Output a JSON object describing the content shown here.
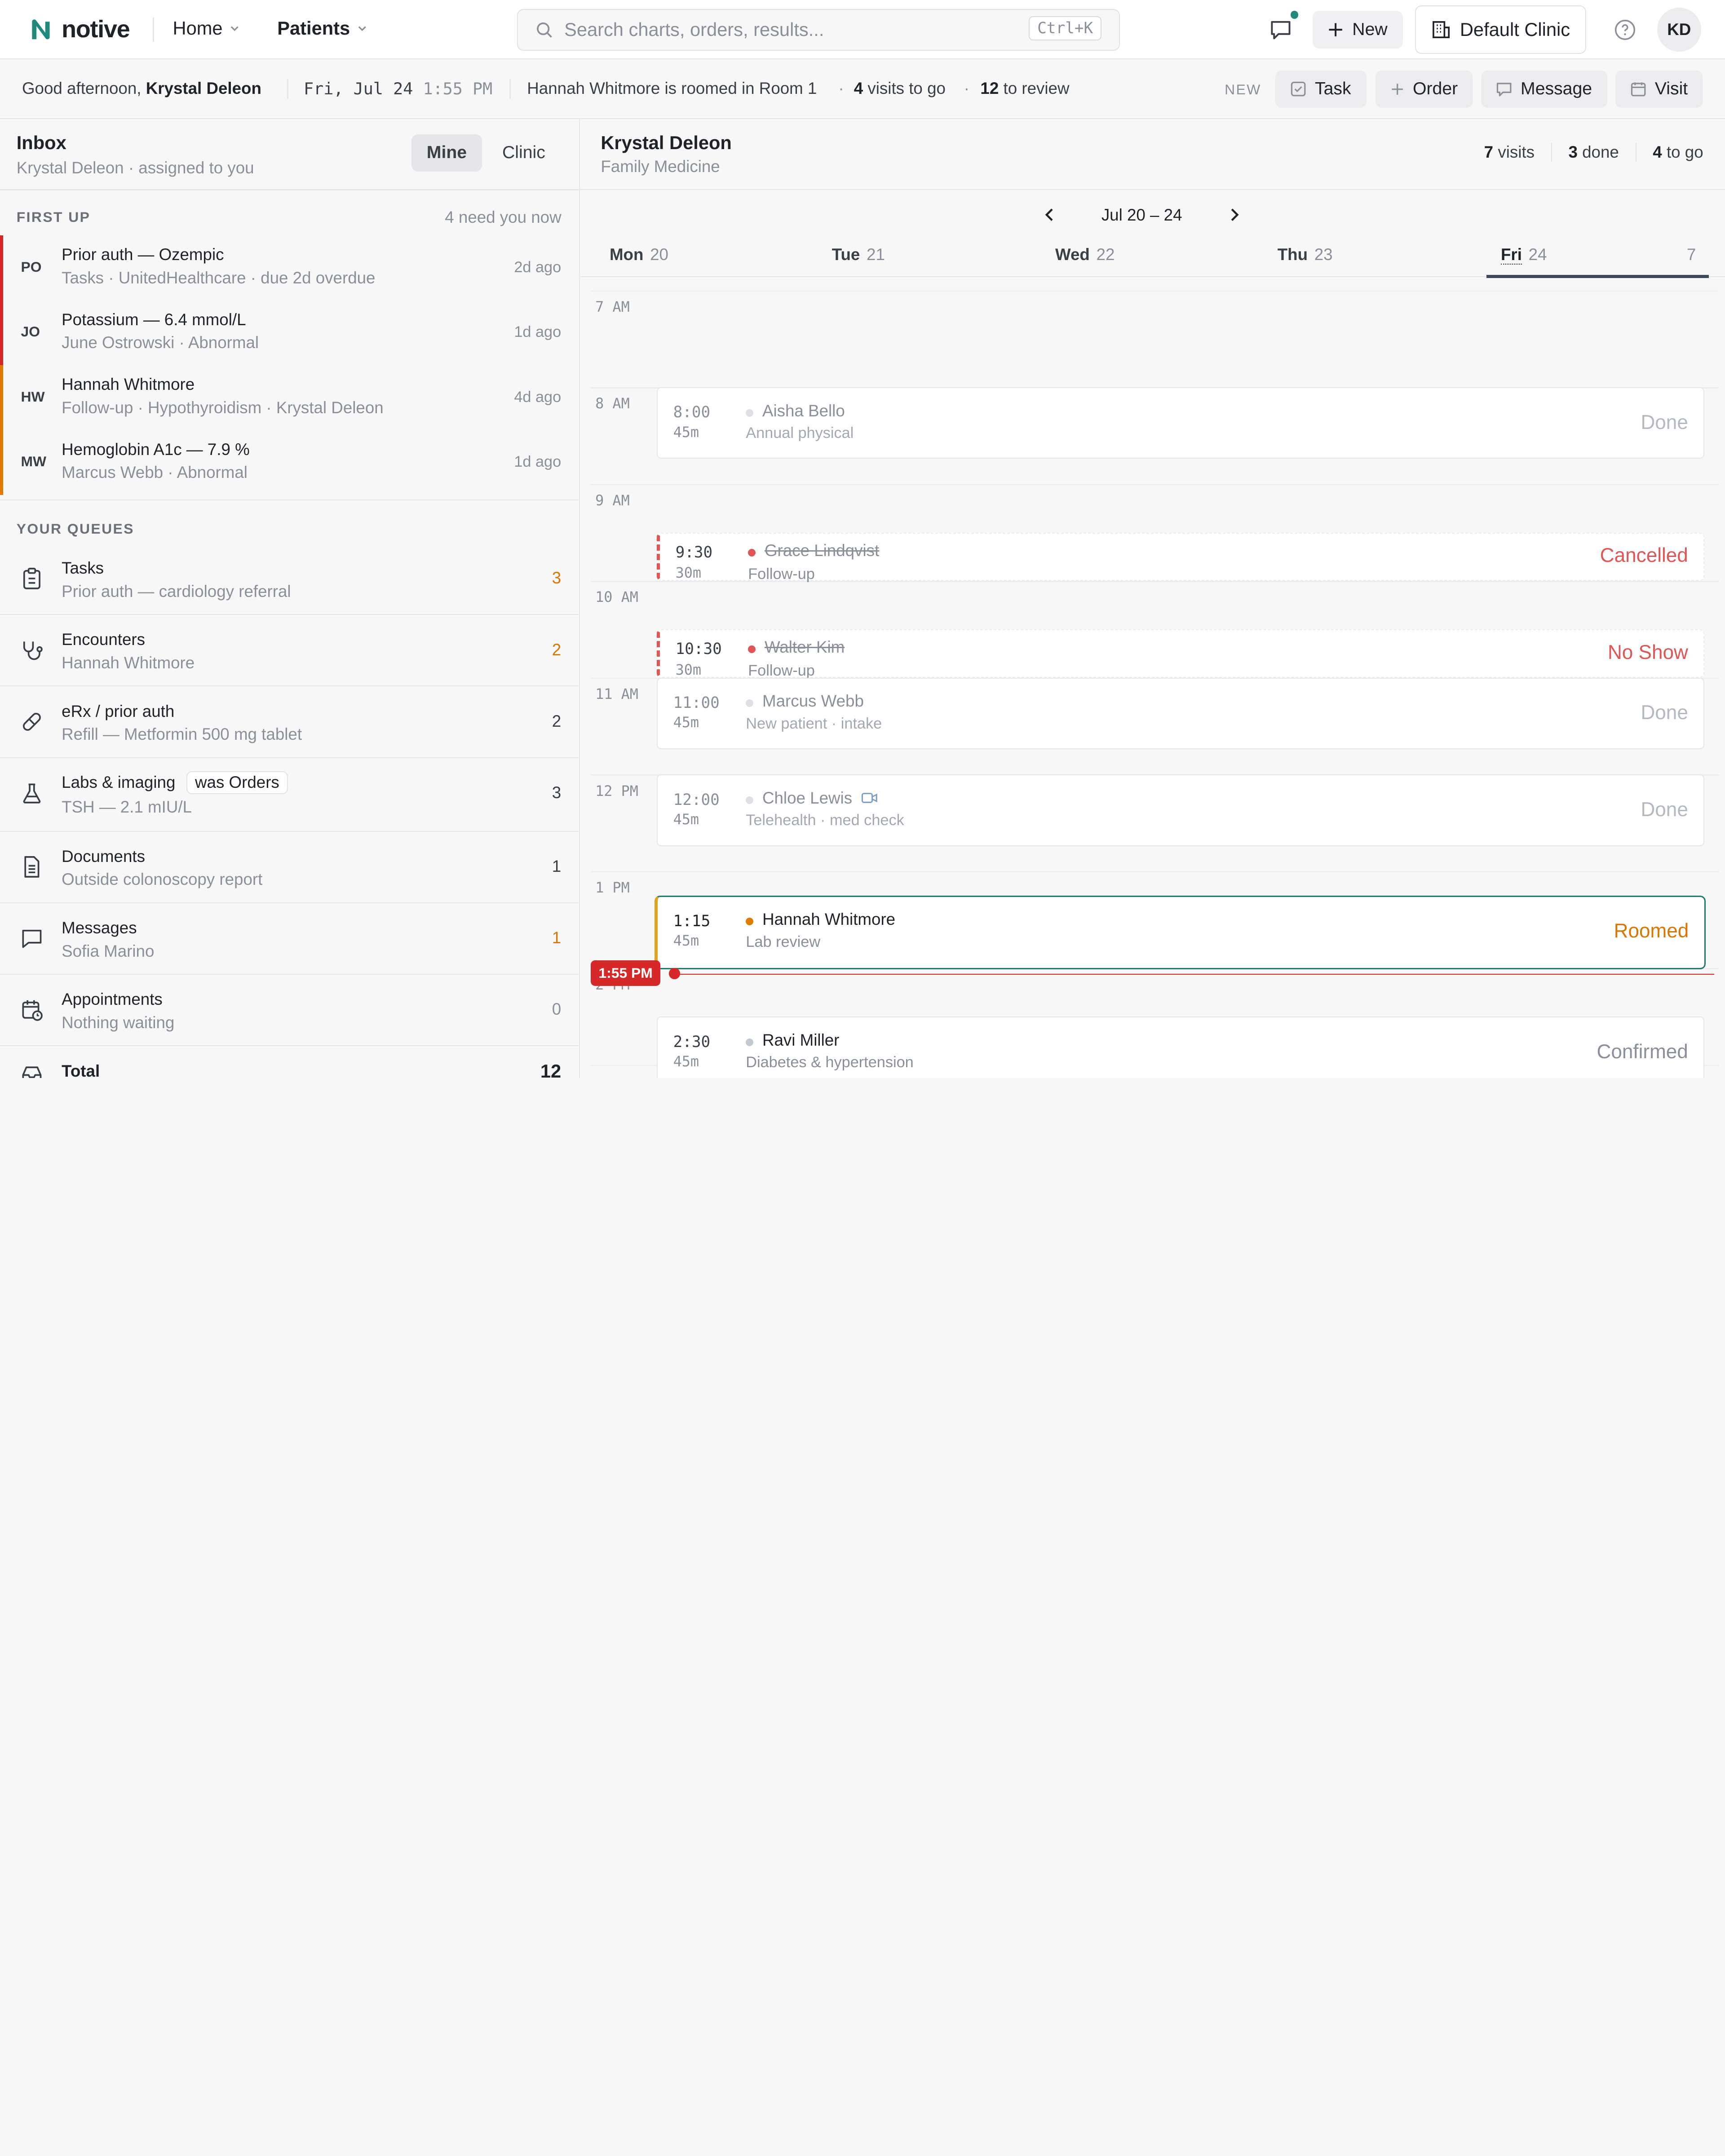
{
  "brand": {
    "name": "notive",
    "color": "#1f8a7c"
  },
  "nav": {
    "home": "Home",
    "patients": "Patients"
  },
  "search": {
    "placeholder": "Search charts, orders, results...",
    "shortcut": "Ctrl+K"
  },
  "header": {
    "new_label": "New",
    "clinic_label": "Default Clinic",
    "avatar": "KD"
  },
  "subbar": {
    "greeting": "Good afternoon,",
    "user": "Krystal Deleon",
    "date": "Fri, Jul 24",
    "time": "1:55 PM",
    "roomed": "Hannah Whitmore is roomed in Room 1",
    "visits_count": "4",
    "visits_label": "visits to go",
    "review_count": "12",
    "review_label": "to review",
    "new_label": "NEW",
    "quick": {
      "task": "Task",
      "order": "Order",
      "message": "Message",
      "visit": "Visit"
    }
  },
  "inbox": {
    "title": "Inbox",
    "subtitle": "Krystal Deleon · assigned to you",
    "tabs": {
      "mine": "Mine",
      "clinic": "Clinic"
    },
    "first_up": {
      "heading": "FIRST UP",
      "note": "4 need you now"
    },
    "items": [
      {
        "initials": "PO",
        "title": "Prior auth — Ozempic",
        "sub": "Tasks · UnitedHealthcare · due 2d overdue",
        "age": "2d ago",
        "color": "#d62828"
      },
      {
        "initials": "JO",
        "title": "Potassium — 6.4 mmol/L",
        "sub": "June Ostrowski · Abnormal",
        "age": "1d ago",
        "color": "#d62828"
      },
      {
        "initials": "HW",
        "title": "Hannah Whitmore",
        "sub": "Follow-up · Hypothyroidism · Krystal Deleon",
        "age": "4d ago",
        "color": "#e07b00"
      },
      {
        "initials": "MW",
        "title": "Hemoglobin A1c — 7.9 %",
        "sub": "Marcus Webb · Abnormal",
        "age": "1d ago",
        "color": "#e07b00"
      }
    ],
    "queues_heading": "YOUR QUEUES",
    "queues": [
      {
        "icon": "clipboard-icon",
        "title": "Tasks",
        "sub": "Prior auth — cardiology referral",
        "count": "3",
        "count_color": "#d97706"
      },
      {
        "icon": "stethoscope-icon",
        "title": "Encounters",
        "sub": "Hannah Whitmore",
        "count": "2",
        "count_color": "#d97706"
      },
      {
        "icon": "pill-icon",
        "title": "eRx / prior auth",
        "sub": "Refill — Metformin 500 mg tablet",
        "count": "2",
        "count_color": "#3a3f46"
      },
      {
        "icon": "flask-icon",
        "title": "Labs & imaging",
        "badge": "was Orders",
        "sub": "TSH — 2.1 mIU/L",
        "count": "3",
        "count_color": "#3a3f46"
      },
      {
        "icon": "document-icon",
        "title": "Documents",
        "sub": "Outside colonoscopy report",
        "count": "1",
        "count_color": "#3a3f46"
      },
      {
        "icon": "message-icon",
        "title": "Messages",
        "sub": "Sofia Marino",
        "count": "1",
        "count_color": "#d97706"
      },
      {
        "icon": "calendar-clock-icon",
        "title": "Appointments",
        "sub": "Nothing waiting",
        "count": "0",
        "count_color": "#8a8f98"
      }
    ],
    "total_label": "Total",
    "total_count": "12"
  },
  "schedule": {
    "provider": "Krystal Deleon",
    "specialty": "Family Medicine",
    "stats": {
      "visits": "7",
      "visits_label": "visits",
      "done": "3",
      "done_label": "done",
      "togo": "4",
      "togo_label": "to go"
    },
    "range": "Jul 20 – 24",
    "days": [
      {
        "name": "Mon",
        "num": "20"
      },
      {
        "name": "Tue",
        "num": "21"
      },
      {
        "name": "Wed",
        "num": "22"
      },
      {
        "name": "Thu",
        "num": "23"
      },
      {
        "name": "Fri",
        "num": "24",
        "count": "7"
      }
    ],
    "hours": [
      "7 AM",
      "8 AM",
      "9 AM",
      "10 AM",
      "11 AM",
      "12 PM",
      "1 PM",
      "2 PM"
    ],
    "now_label": "1:55 PM",
    "appointments": [
      {
        "time": "8:00",
        "dur": "45m",
        "name": "Aisha Bello",
        "desc": "Annual physical",
        "status": "Done"
      },
      {
        "time": "9:30",
        "dur": "30m",
        "name": "Grace Lindqvist",
        "desc": "Follow-up",
        "status": "Cancelled"
      },
      {
        "time": "10:30",
        "dur": "30m",
        "name": "Walter Kim",
        "desc": "Follow-up",
        "status": "No Show"
      },
      {
        "time": "11:00",
        "dur": "45m",
        "name": "Marcus Webb",
        "desc": "New patient · intake",
        "status": "Done"
      },
      {
        "time": "12:00",
        "dur": "45m",
        "name": "Chloe Lewis",
        "desc": "Telehealth · med check",
        "status": "Done"
      },
      {
        "time": "1:15",
        "dur": "45m",
        "name": "Hannah Whitmore",
        "desc": "Lab review",
        "status": "Roomed"
      },
      {
        "time": "2:30",
        "dur": "45m",
        "name": "Ravi Miller",
        "desc": "Diabetes & hypertension",
        "status": "Confirmed"
      }
    ]
  }
}
